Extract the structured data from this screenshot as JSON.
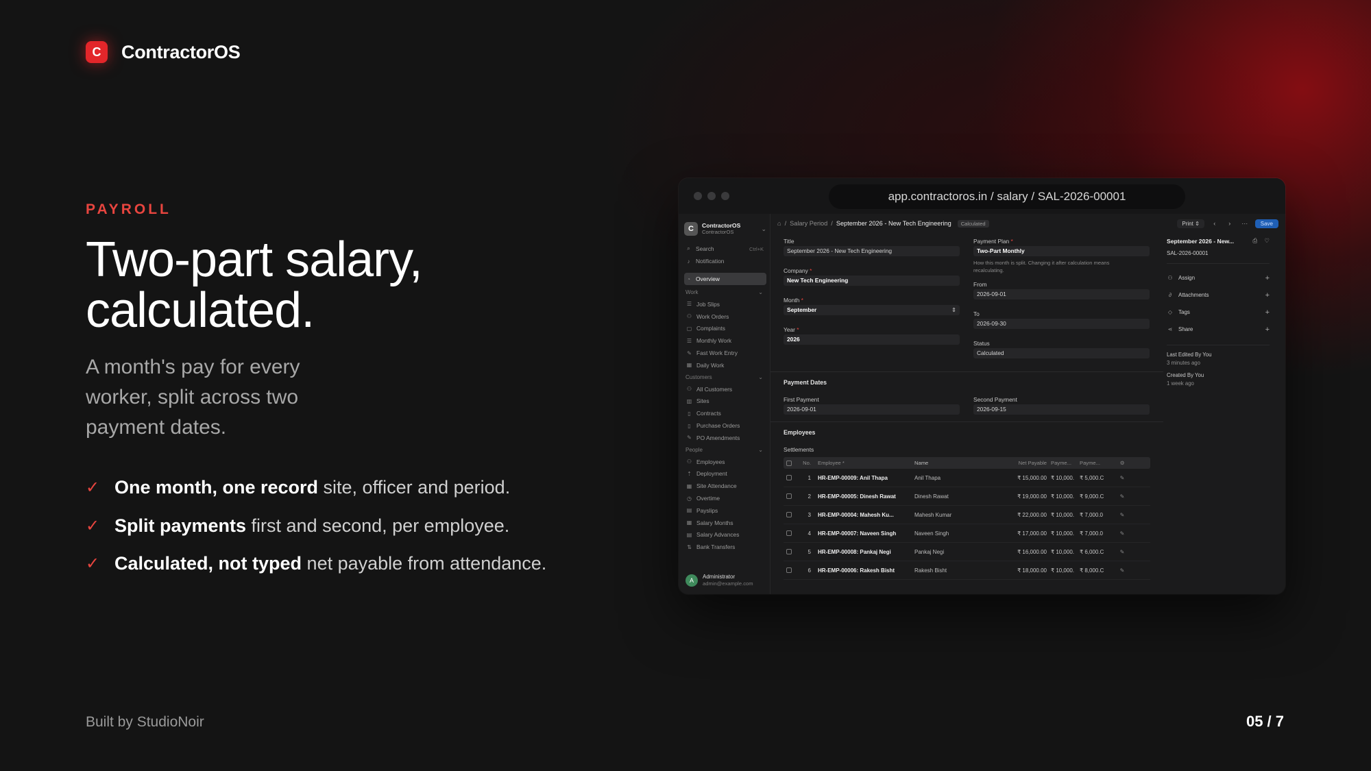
{
  "brand": {
    "logo_letter": "C",
    "name": "ContractorOS",
    "accent": "#e3262a"
  },
  "hero": {
    "eyebrow": "PAYROLL",
    "headline_line1": "Two-part salary,",
    "headline_line2": "calculated.",
    "subhead": "A month's pay for every worker, split across two payment dates."
  },
  "features": [
    {
      "bold": "One month, one record",
      "rest": " site, officer and period."
    },
    {
      "bold": "Split payments",
      "rest": " first and second, per employee."
    },
    {
      "bold": "Calculated, not typed",
      "rest": " net payable from attendance."
    }
  ],
  "footer": {
    "credit": "Built by StudioNoir",
    "page": "05 / 7"
  },
  "window": {
    "url": "app.contractoros.in / salary / SAL-2026-00001",
    "sidebar": {
      "workspace_logo": "C",
      "workspace_name": "ContractorOS",
      "workspace_sub": "ContractorOS",
      "search_label": "Search",
      "search_shortcut": "Ctrl+K",
      "notification_label": "Notification",
      "overview_label": "Overview",
      "sections": [
        {
          "title": "Work",
          "items": [
            {
              "label": "Job Slips",
              "icon": "list-icon"
            },
            {
              "label": "Work Orders",
              "icon": "person-icon"
            },
            {
              "label": "Complaints",
              "icon": "chat-icon"
            },
            {
              "label": "Monthly Work",
              "icon": "list-icon"
            },
            {
              "label": "Fast Work Entry",
              "icon": "pen-icon"
            },
            {
              "label": "Daily Work",
              "icon": "calendar-icon"
            }
          ]
        },
        {
          "title": "Customers",
          "items": [
            {
              "label": "All Customers",
              "icon": "people-icon"
            },
            {
              "label": "Sites",
              "icon": "map-icon"
            },
            {
              "label": "Contracts",
              "icon": "file-icon"
            },
            {
              "label": "Purchase Orders",
              "icon": "file-icon"
            },
            {
              "label": "PO Amendments",
              "icon": "pen-icon"
            }
          ]
        },
        {
          "title": "People",
          "items": [
            {
              "label": "Employees",
              "icon": "person-icon"
            },
            {
              "label": "Deployment",
              "icon": "upload-icon"
            },
            {
              "label": "Site Attendance",
              "icon": "calendar-icon"
            },
            {
              "label": "Overtime",
              "icon": "clock-icon"
            },
            {
              "label": "Payslips",
              "icon": "receipt-icon"
            },
            {
              "label": "Salary Months",
              "icon": "calendar-icon"
            },
            {
              "label": "Salary Advances",
              "icon": "receipt-icon"
            },
            {
              "label": "Bank Transfers",
              "icon": "transfer-icon"
            }
          ]
        }
      ],
      "user_initial": "A",
      "user_name": "Administrator",
      "user_email": "admin@example.com"
    },
    "topbar": {
      "crumb_parent": "Salary Period",
      "crumb_current": "September 2026 - New Tech Engineering",
      "status_badge": "Calculated",
      "print_label": "Print",
      "save_label": "Save"
    },
    "form": {
      "title_label": "Title",
      "title_value": "September 2026 - New Tech Engineering",
      "company_label": "Company",
      "company_value": "New Tech Engineering",
      "month_label": "Month",
      "month_value": "September",
      "year_label": "Year",
      "year_value": "2026",
      "plan_label": "Payment Plan",
      "plan_value": "Two-Part Monthly",
      "plan_hint": "How this month is split. Changing it after calculation means recalculating.",
      "from_label": "From",
      "from_value": "2026-09-01",
      "to_label": "To",
      "to_value": "2026-09-30",
      "status_label": "Status",
      "status_value": "Calculated",
      "payment_dates_heading": "Payment Dates",
      "first_payment_label": "First Payment",
      "first_payment_value": "2026-09-01",
      "second_payment_label": "Second Payment",
      "second_payment_value": "2026-09-15",
      "employees_heading": "Employees",
      "settlements_label": "Settlements"
    },
    "table": {
      "columns": {
        "no": "No.",
        "employee": "Employee *",
        "name": "Name",
        "net": "Net Payable",
        "p1": "Payme...",
        "p2": "Payme..."
      },
      "rows": [
        {
          "no": "1",
          "employee": "HR-EMP-00009: Anil Thapa",
          "name": "Anil Thapa",
          "net": "₹ 15,000.00",
          "p1": "₹ 10,000.",
          "p2": "₹ 5,000.C"
        },
        {
          "no": "2",
          "employee": "HR-EMP-00005: Dinesh Rawat",
          "name": "Dinesh Rawat",
          "net": "₹ 19,000.00",
          "p1": "₹ 10,000.",
          "p2": "₹ 9,000.C"
        },
        {
          "no": "3",
          "employee": "HR-EMP-00004: Mahesh Ku...",
          "name": "Mahesh Kumar",
          "net": "₹ 22,000.00",
          "p1": "₹ 10,000.",
          "p2": "₹ 7,000.0"
        },
        {
          "no": "4",
          "employee": "HR-EMP-00007: Naveen Singh",
          "name": "Naveen Singh",
          "net": "₹ 17,000.00",
          "p1": "₹ 10,000.",
          "p2": "₹ 7,000.0"
        },
        {
          "no": "5",
          "employee": "HR-EMP-00008: Pankaj Negi",
          "name": "Pankaj Negi",
          "net": "₹ 16,000.00",
          "p1": "₹ 10,000.",
          "p2": "₹ 6,000.C"
        },
        {
          "no": "6",
          "employee": "HR-EMP-00006: Rakesh Bisht",
          "name": "Rakesh Bisht",
          "net": "₹ 18,000.00",
          "p1": "₹ 10,000.",
          "p2": "₹ 8,000.C"
        }
      ]
    },
    "meta": {
      "title": "September 2026 - New...",
      "id": "SAL-2026-00001",
      "assign_label": "Assign",
      "attachments_label": "Attachments",
      "tags_label": "Tags",
      "share_label": "Share",
      "last_edited_label": "Last Edited By You",
      "last_edited_value": "3 minutes ago",
      "created_label": "Created By You",
      "created_value": "1 week ago"
    }
  }
}
